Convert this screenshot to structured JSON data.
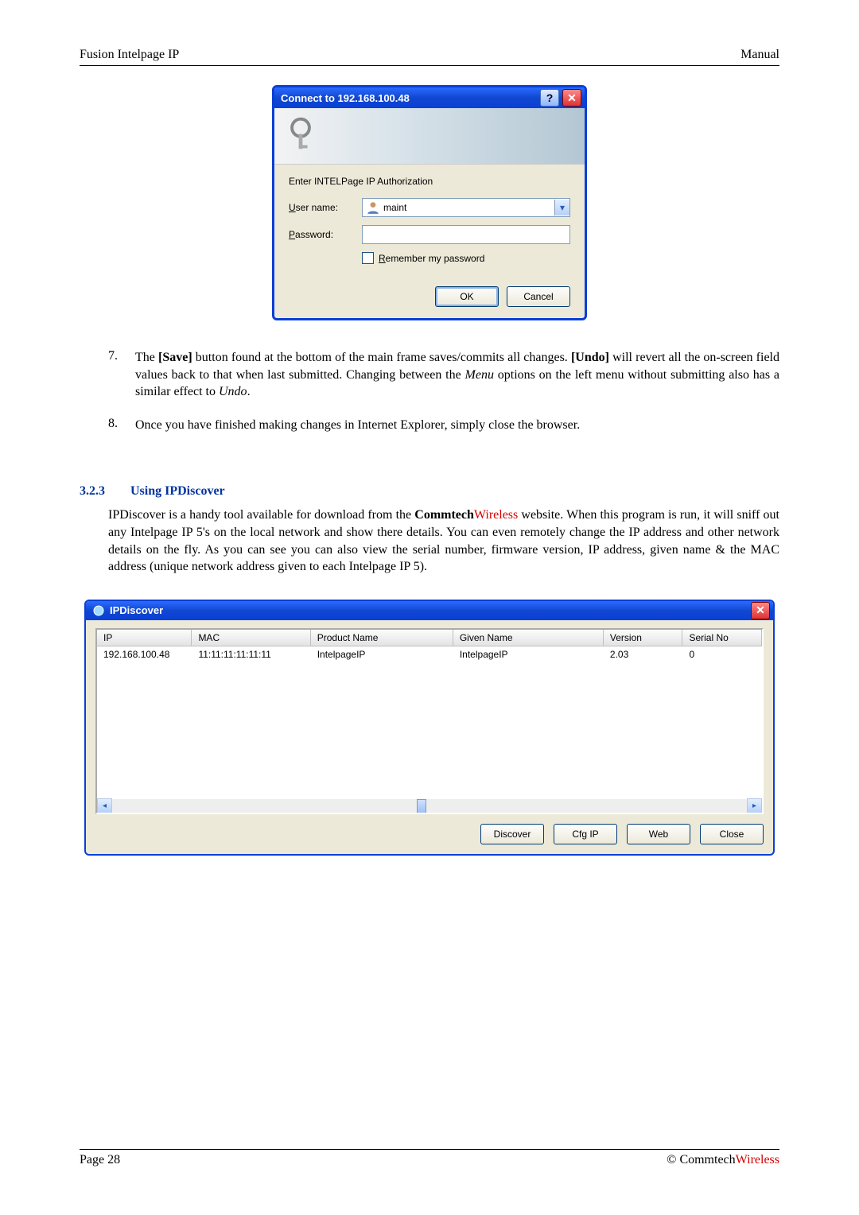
{
  "header": {
    "left": "Fusion Intelpage IP",
    "right": "Manual"
  },
  "footer": {
    "left": "Page 28",
    "right_a": "© Commtech",
    "right_b": "Wireless"
  },
  "auth_dialog": {
    "title": "Connect to 192.168.100.48",
    "prompt": "Enter INTELPage IP Authorization",
    "username_u": "U",
    "username_rest": "ser name:",
    "password_u": "P",
    "password_rest": "assword:",
    "username_value": "maint",
    "remember_u": "R",
    "remember_rest": "emember my password",
    "ok_label": "OK",
    "cancel_label": "Cancel"
  },
  "list": {
    "seven_num": "7.",
    "seven_a": "The ",
    "seven_b": "[Save]",
    "seven_c": " button found at the bottom of the main frame saves/commits all changes. ",
    "seven_d": "[Undo]",
    "seven_e": " will revert all the on-screen field values back to that when last submitted. Changing between the ",
    "seven_f": "Menu",
    "seven_g": " options on the left menu without submitting also has a similar effect to ",
    "seven_h": "Undo",
    "seven_i": ".",
    "eight_num": "8.",
    "eight_a": "Once you have finished making changes in Internet Explorer, simply close the browser."
  },
  "section": {
    "num": "3.2.3",
    "title": "Using IPDiscover",
    "p_a": "IPDiscover is a handy tool available for download from the ",
    "p_b": "Commtech",
    "p_c": "Wireless",
    "p_d": " website. When this program is run, it will sniff out any Intelpage IP 5's on the local network and show there details. You can even remotely change the IP address and other network details on the fly. As you can see you can also view the serial number, firmware version, IP address, given name & the MAC address (unique network address given to each Intelpage IP 5)."
  },
  "ipd": {
    "title": "IPDiscover",
    "cols": {
      "ip": "IP",
      "mac": "MAC",
      "pn": "Product Name",
      "gn": "Given Name",
      "ver": "Version",
      "sn": "Serial No"
    },
    "rows": [
      {
        "ip": "192.168.100.48",
        "mac": "11:11:11:11:11:11",
        "pn": "IntelpageIP",
        "gn": "IntelpageIP",
        "ver": "2.03",
        "sn": "0"
      }
    ],
    "buttons": {
      "discover": "Discover",
      "cfgip": "Cfg IP",
      "web": "Web",
      "close": "Close"
    }
  }
}
